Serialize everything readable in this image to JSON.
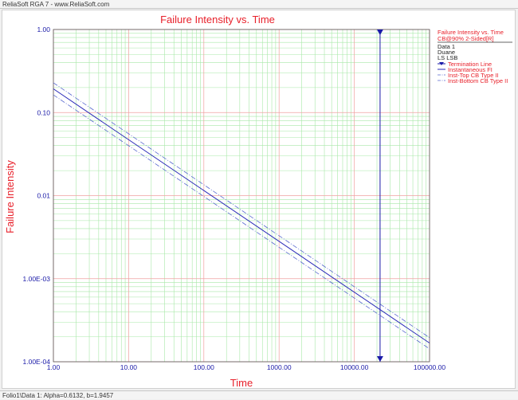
{
  "app": {
    "title": "ReliaSoft RGA 7 - www.ReliaSoft.com",
    "status": "Folio1\\Data 1: Alpha=0.6132, b=1.9457"
  },
  "colors": {
    "title": "#e8202a",
    "axis_label": "#e8202a",
    "tick_label": "#1a1aa8",
    "series_main": "#2a2ab8",
    "series_bounds": "#5a6ad0",
    "grid_major": "#f0a0a0",
    "grid_minor": "#a8e8a8",
    "termination": "#1a1aa8"
  },
  "chart_data": {
    "type": "line",
    "title": "Failure Intensity vs. Time",
    "xlabel": "Time",
    "ylabel": "Failure Intensity",
    "xscale": "log",
    "yscale": "log",
    "xlim": [
      1,
      100000
    ],
    "ylim": [
      0.0001,
      1
    ],
    "grid": true,
    "x_ticks": [
      "1.00",
      "10.00",
      "100.00",
      "1000.00",
      "10000.00",
      "100000.00"
    ],
    "y_ticks": [
      "1.00E-04",
      "1.00E-03",
      "0.01",
      "0.10",
      "1.00"
    ],
    "termination_time": 22000,
    "series": [
      {
        "name": "Instantaneous FI",
        "style": "solid",
        "x": [
          1,
          100000
        ],
        "y": [
          0.193,
          0.000168
        ]
      },
      {
        "name": "Inst-Top CB Type II",
        "style": "dashdot",
        "x": [
          1,
          100000
        ],
        "y": [
          0.228,
          0.000195
        ]
      },
      {
        "name": "Inst-Bottom CB Type II",
        "style": "dashdot",
        "x": [
          1,
          100000
        ],
        "y": [
          0.163,
          0.000143
        ]
      }
    ],
    "legend": {
      "position": "right",
      "header_lines": [
        "Failure Intensity vs. Time",
        "CB@90% 2-Sided[R]"
      ],
      "info_lines": [
        "Data 1",
        "Duane",
        "LS LSB"
      ],
      "entries": [
        {
          "label": "Termination Line",
          "marker": "triangle"
        },
        {
          "label": "Instantaneous FI",
          "style": "solid"
        },
        {
          "label": "Inst-Top CB Type II",
          "style": "dashdot"
        },
        {
          "label": "Inst-Bottom CB Type II",
          "style": "dashdot"
        }
      ]
    }
  }
}
